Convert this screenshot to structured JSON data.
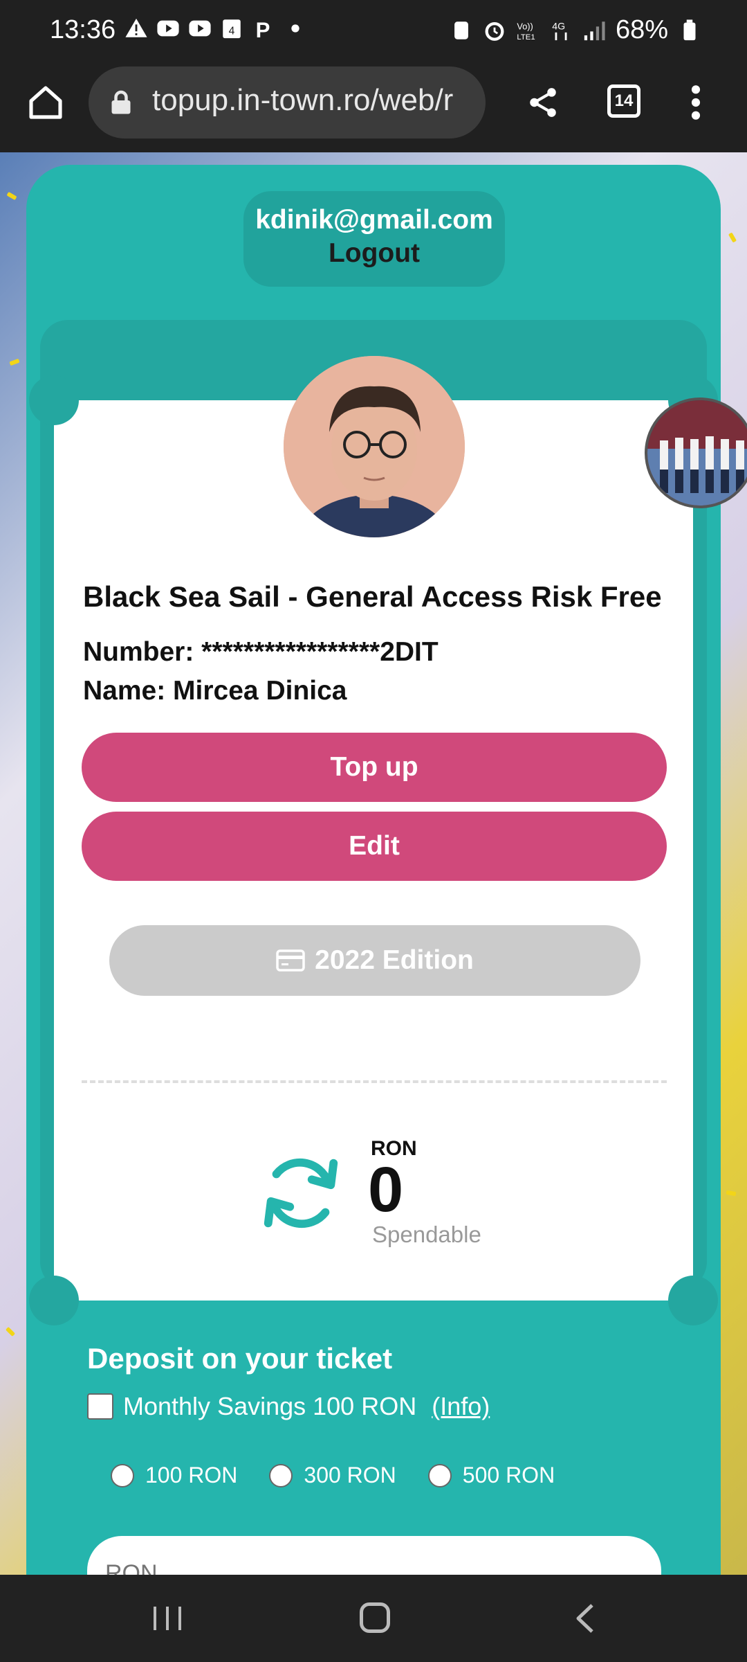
{
  "status_bar": {
    "time": "13:36",
    "battery": "68%",
    "notification_icons": [
      "warning-icon",
      "youtube-icon",
      "youtube-icon",
      "calendar-icon",
      "parking-icon",
      "dot-icon"
    ],
    "system_icons": [
      "recycle-icon",
      "alarm-icon",
      "volte-icon",
      "4g-icon",
      "signal-icon",
      "battery-icon"
    ]
  },
  "browser": {
    "url": "topup.in-town.ro/web/r",
    "tab_count": "14"
  },
  "account": {
    "email": "kdinik@gmail.com",
    "logout_label": "Logout"
  },
  "ticket": {
    "title": "Black Sea Sail - General Access Risk Free",
    "number": "Number: *****************2DIT",
    "name": "Name: Mircea Dinica",
    "topup_label": "Top up",
    "edit_label": "Edit",
    "edition_label": "2022 Edition",
    "currency": "RON",
    "balance": "0",
    "balance_caption": "Spendable"
  },
  "deposit": {
    "title": "Deposit on your ticket",
    "savings_label": "Monthly Savings 100 RON",
    "info_label": "(Info)",
    "options": [
      "100 RON",
      "300 RON",
      "500 RON"
    ],
    "input_placeholder": "RON"
  },
  "colors": {
    "teal": "#25b5ad",
    "pink": "#d0497b",
    "gray_pill": "#cbcbcb"
  }
}
